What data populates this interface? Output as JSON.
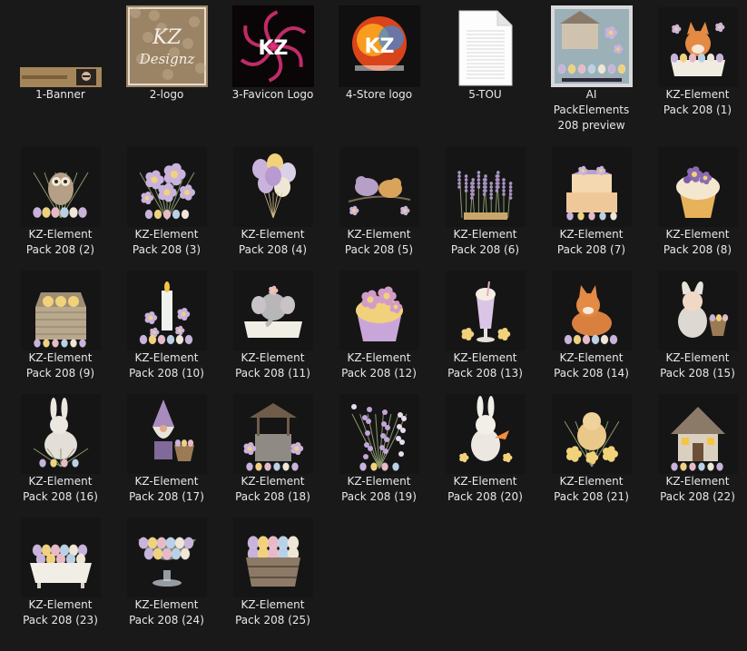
{
  "files": [
    {
      "name": "1-Banner",
      "kind": "banner"
    },
    {
      "name": "2-logo",
      "kind": "logo-beige",
      "logo_text": "KZ Designz"
    },
    {
      "name": "3-Favicon Logo",
      "kind": "logo-pink",
      "logo_text": "KZ"
    },
    {
      "name": "4-Store logo",
      "kind": "logo-fire",
      "logo_text": "KZ"
    },
    {
      "name": "5-TOU",
      "kind": "document-icon"
    },
    {
      "name": "AI PackElements 208 preview",
      "kind": "preview-frame"
    },
    {
      "name": "KZ-Element Pack 208 (1)",
      "kind": "fox-in-tub"
    },
    {
      "name": "KZ-Element Pack 208 (2)",
      "kind": "owl"
    },
    {
      "name": "KZ-Element Pack 208 (3)",
      "kind": "flowers"
    },
    {
      "name": "KZ-Element Pack 208 (4)",
      "kind": "balloons"
    },
    {
      "name": "KZ-Element Pack 208 (5)",
      "kind": "birds"
    },
    {
      "name": "KZ-Element Pack 208 (6)",
      "kind": "lavender"
    },
    {
      "name": "KZ-Element Pack 208 (7)",
      "kind": "cake"
    },
    {
      "name": "KZ-Element Pack 208 (8)",
      "kind": "cupcake"
    },
    {
      "name": "KZ-Element Pack 208 (9)",
      "kind": "chicks-basket"
    },
    {
      "name": "KZ-Element Pack 208 (10)",
      "kind": "candle"
    },
    {
      "name": "KZ-Element Pack 208 (11)",
      "kind": "elephant-tub"
    },
    {
      "name": "KZ-Element Pack 208 (12)",
      "kind": "cupcake-flowers"
    },
    {
      "name": "KZ-Element Pack 208 (13)",
      "kind": "milkshake"
    },
    {
      "name": "KZ-Element Pack 208 (14)",
      "kind": "fox"
    },
    {
      "name": "KZ-Element Pack 208 (15)",
      "kind": "bunny-child"
    },
    {
      "name": "KZ-Element Pack 208 (16)",
      "kind": "bunny"
    },
    {
      "name": "KZ-Element Pack 208 (17)",
      "kind": "gnome"
    },
    {
      "name": "KZ-Element Pack 208 (18)",
      "kind": "well"
    },
    {
      "name": "KZ-Element Pack 208 (19)",
      "kind": "blossoms"
    },
    {
      "name": "KZ-Element Pack 208 (20)",
      "kind": "bunny-carrot"
    },
    {
      "name": "KZ-Element Pack 208 (21)",
      "kind": "chick-flowers"
    },
    {
      "name": "KZ-Element Pack 208 (22)",
      "kind": "cottage"
    },
    {
      "name": "KZ-Element Pack 208 (23)",
      "kind": "egg-tub"
    },
    {
      "name": "KZ-Element Pack 208 (24)",
      "kind": "glass-bowl"
    },
    {
      "name": "KZ-Element Pack 208 (25)",
      "kind": "bucket-eggs"
    }
  ],
  "display_labels": [
    "1-Banner",
    "2-logo",
    "3-Favicon Logo",
    "4-Store logo",
    "5-TOU",
    "AI\nPackElements\n208 preview",
    "KZ-Element\nPack 208 (1)",
    "KZ-Element\nPack 208 (2)",
    "KZ-Element\nPack 208 (3)",
    "KZ-Element\nPack 208 (4)",
    "KZ-Element\nPack 208 (5)",
    "KZ-Element\nPack 208 (6)",
    "KZ-Element\nPack 208 (7)",
    "KZ-Element\nPack 208 (8)",
    "KZ-Element\nPack 208 (9)",
    "KZ-Element\nPack 208 (10)",
    "KZ-Element\nPack 208 (11)",
    "KZ-Element\nPack 208 (12)",
    "KZ-Element\nPack 208 (13)",
    "KZ-Element\nPack 208 (14)",
    "KZ-Element\nPack 208 (15)",
    "KZ-Element\nPack 208 (16)",
    "KZ-Element\nPack 208 (17)",
    "KZ-Element\nPack 208 (18)",
    "KZ-Element\nPack 208 (19)",
    "KZ-Element\nPack 208 (20)",
    "KZ-Element\nPack 208 (21)",
    "KZ-Element\nPack 208 (22)",
    "KZ-Element\nPack 208 (23)",
    "KZ-Element\nPack 208 (24)",
    "KZ-Element\nPack 208 (25)"
  ],
  "colors": {
    "background": "#191919",
    "label_text": "#e8e8e8",
    "lavender": "#c9b2dc",
    "pastel_yellow": "#f1d27a",
    "pastel_pink": "#e9b9c8",
    "pastel_blue": "#b9d1e6",
    "cream": "#efe6d6",
    "logo_pink": "#e0337a",
    "logo_fire": "#f04a1d"
  }
}
